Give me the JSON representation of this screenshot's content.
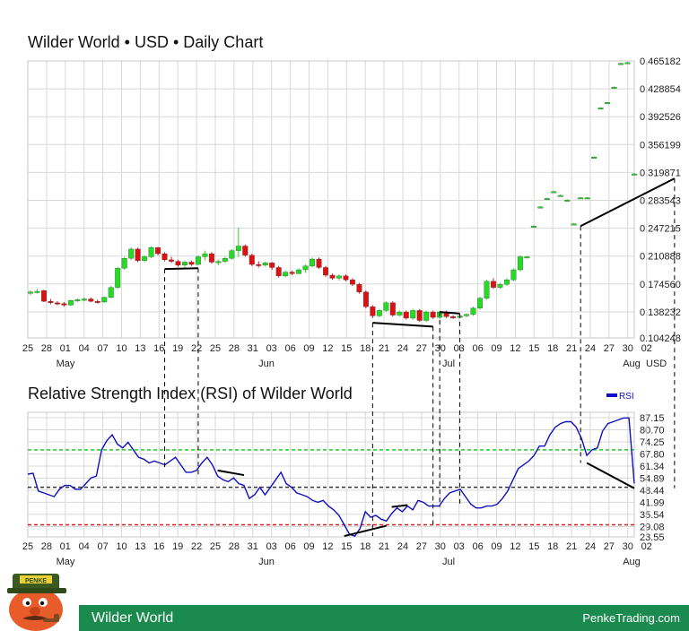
{
  "chart_data": [
    {
      "type": "candlestick",
      "title": "Wilder World • USD • Daily Chart",
      "y_unit": "USD",
      "ylim": [
        0.104248,
        0.465182
      ],
      "y_ticks": [
        "0.465182",
        "0.428854",
        "0.392526",
        "0.356199",
        "0.319871",
        "0.283543",
        "0.247215",
        "0.210888",
        "0.174560",
        "0.138232",
        "0.104248"
      ],
      "x_tick_labels": [
        "25",
        "28",
        "01",
        "04",
        "07",
        "10",
        "13",
        "16",
        "19",
        "22",
        "25",
        "28",
        "31",
        "03",
        "06",
        "09",
        "12",
        "15",
        "18",
        "21",
        "24",
        "27",
        "30",
        "03",
        "06",
        "09",
        "12",
        "15",
        "18",
        "21",
        "24",
        "27",
        "30",
        "02"
      ],
      "month_labels": [
        "May",
        "Jun",
        "Jul",
        "Aug"
      ],
      "grid": true,
      "ohlc": [
        [
          0.163,
          0.166,
          0.16,
          0.164
        ],
        [
          0.164,
          0.168,
          0.162,
          0.165
        ],
        [
          0.166,
          0.167,
          0.151,
          0.152
        ],
        [
          0.152,
          0.155,
          0.148,
          0.15
        ],
        [
          0.15,
          0.152,
          0.147,
          0.149
        ],
        [
          0.149,
          0.151,
          0.145,
          0.147
        ],
        [
          0.147,
          0.154,
          0.146,
          0.153
        ],
        [
          0.153,
          0.156,
          0.151,
          0.154
        ],
        [
          0.154,
          0.157,
          0.152,
          0.155
        ],
        [
          0.155,
          0.157,
          0.151,
          0.152
        ],
        [
          0.152,
          0.154,
          0.149,
          0.151
        ],
        [
          0.151,
          0.158,
          0.15,
          0.157
        ],
        [
          0.157,
          0.172,
          0.156,
          0.17
        ],
        [
          0.17,
          0.197,
          0.168,
          0.195
        ],
        [
          0.195,
          0.21,
          0.193,
          0.208
        ],
        [
          0.208,
          0.222,
          0.206,
          0.22
        ],
        [
          0.22,
          0.222,
          0.203,
          0.205
        ],
        [
          0.205,
          0.212,
          0.203,
          0.21
        ],
        [
          0.21,
          0.224,
          0.208,
          0.222
        ],
        [
          0.222,
          0.223,
          0.212,
          0.214
        ],
        [
          0.214,
          0.216,
          0.204,
          0.206
        ],
        [
          0.206,
          0.21,
          0.202,
          0.204
        ],
        [
          0.204,
          0.206,
          0.197,
          0.199
        ],
        [
          0.199,
          0.205,
          0.196,
          0.203
        ],
        [
          0.203,
          0.205,
          0.198,
          0.2
        ],
        [
          0.2,
          0.212,
          0.199,
          0.21
        ],
        [
          0.21,
          0.218,
          0.205,
          0.214
        ],
        [
          0.214,
          0.216,
          0.201,
          0.203
        ],
        [
          0.203,
          0.206,
          0.199,
          0.204
        ],
        [
          0.204,
          0.21,
          0.202,
          0.208
        ],
        [
          0.208,
          0.22,
          0.206,
          0.218
        ],
        [
          0.218,
          0.248,
          0.21,
          0.224
        ],
        [
          0.224,
          0.226,
          0.21,
          0.212
        ],
        [
          0.212,
          0.214,
          0.198,
          0.2
        ],
        [
          0.2,
          0.204,
          0.196,
          0.199
        ],
        [
          0.199,
          0.204,
          0.197,
          0.202
        ],
        [
          0.202,
          0.203,
          0.193,
          0.196
        ],
        [
          0.196,
          0.198,
          0.183,
          0.185
        ],
        [
          0.185,
          0.192,
          0.183,
          0.19
        ],
        [
          0.19,
          0.192,
          0.186,
          0.188
        ],
        [
          0.188,
          0.195,
          0.187,
          0.193
        ],
        [
          0.193,
          0.2,
          0.189,
          0.198
        ],
        [
          0.198,
          0.209,
          0.196,
          0.207
        ],
        [
          0.207,
          0.209,
          0.194,
          0.196
        ],
        [
          0.196,
          0.198,
          0.184,
          0.186
        ],
        [
          0.186,
          0.188,
          0.18,
          0.182
        ],
        [
          0.182,
          0.187,
          0.179,
          0.185
        ],
        [
          0.185,
          0.187,
          0.178,
          0.18
        ],
        [
          0.18,
          0.182,
          0.172,
          0.174
        ],
        [
          0.174,
          0.176,
          0.162,
          0.164
        ],
        [
          0.164,
          0.166,
          0.143,
          0.145
        ],
        [
          0.145,
          0.147,
          0.13,
          0.133
        ],
        [
          0.133,
          0.142,
          0.131,
          0.14
        ],
        [
          0.14,
          0.152,
          0.138,
          0.15
        ],
        [
          0.15,
          0.152,
          0.132,
          0.134
        ],
        [
          0.134,
          0.14,
          0.132,
          0.138
        ],
        [
          0.138,
          0.14,
          0.128,
          0.13
        ],
        [
          0.13,
          0.142,
          0.128,
          0.14
        ],
        [
          0.14,
          0.142,
          0.125,
          0.127
        ],
        [
          0.127,
          0.14,
          0.125,
          0.138
        ],
        [
          0.138,
          0.14,
          0.129,
          0.131
        ],
        [
          0.131,
          0.14,
          0.129,
          0.138
        ],
        [
          0.138,
          0.14,
          0.13,
          0.132
        ],
        [
          0.132,
          0.134,
          0.129,
          0.131
        ],
        [
          0.131,
          0.134,
          0.13,
          0.133
        ],
        [
          0.133,
          0.136,
          0.131,
          0.135
        ],
        [
          0.135,
          0.145,
          0.133,
          0.143
        ],
        [
          0.143,
          0.158,
          0.141,
          0.156
        ],
        [
          0.156,
          0.18,
          0.154,
          0.178
        ],
        [
          0.178,
          0.182,
          0.168,
          0.17
        ],
        [
          0.17,
          0.176,
          0.168,
          0.174
        ],
        [
          0.174,
          0.182,
          0.172,
          0.18
        ],
        [
          0.18,
          0.195,
          0.178,
          0.193
        ],
        [
          0.193,
          0.212,
          0.191,
          0.21
        ],
        [
          0.21,
          0.211,
          0.209,
          0.21
        ],
        [
          0.25,
          0.251,
          0.249,
          0.25
        ],
        [
          0.275,
          0.276,
          0.274,
          0.275
        ],
        [
          0.286,
          0.287,
          0.285,
          0.286
        ],
        [
          0.295,
          0.296,
          0.294,
          0.295
        ],
        [
          0.29,
          0.291,
          0.289,
          0.29
        ],
        [
          0.284,
          0.285,
          0.283,
          0.284
        ],
        [
          0.253,
          0.254,
          0.252,
          0.253
        ],
        [
          0.287,
          0.288,
          0.286,
          0.287
        ],
        [
          0.287,
          0.288,
          0.286,
          0.287
        ],
        [
          0.34,
          0.341,
          0.339,
          0.34
        ],
        [
          0.404,
          0.405,
          0.403,
          0.404
        ],
        [
          0.411,
          0.412,
          0.41,
          0.411
        ],
        [
          0.431,
          0.432,
          0.43,
          0.431
        ],
        [
          0.462,
          0.463,
          0.461,
          0.462
        ],
        [
          0.463,
          0.464,
          0.462,
          0.463
        ],
        [
          0.318,
          0.319,
          0.317,
          0.318
        ]
      ],
      "trend_lines": [
        {
          "from": [
            20,
            0.194
          ],
          "to": [
            25,
            0.195
          ]
        },
        {
          "from": [
            51,
            0.124
          ],
          "to": [
            60,
            0.119
          ]
        },
        {
          "from": [
            61,
            0.138
          ],
          "to": [
            64,
            0.136
          ]
        },
        {
          "from": [
            82,
            0.25
          ],
          "to": [
            96,
            0.312
          ]
        }
      ]
    },
    {
      "type": "line",
      "title": "Relative Strength Index (RSI) of Wilder World",
      "legend": "RSI",
      "legend_position": "top-right",
      "ylim": [
        23.55,
        90
      ],
      "y_ticks": [
        "87.15",
        "80.70",
        "74.25",
        "67.80",
        "61.34",
        "54.89",
        "48.44",
        "41.99",
        "35.54",
        "29.08",
        "23.55"
      ],
      "reference_lines": [
        {
          "value": 70,
          "color": "#22cc22"
        },
        {
          "value": 50,
          "color": "#333333"
        },
        {
          "value": 30,
          "color": "#dd2222"
        }
      ],
      "series": [
        {
          "name": "RSI",
          "color": "#1010c0",
          "values": [
            57,
            57.5,
            48,
            47,
            46,
            45,
            49,
            51,
            51,
            49,
            49,
            52,
            55,
            56,
            70,
            75,
            78,
            73,
            71,
            74,
            70,
            66,
            65,
            63,
            64,
            63,
            62,
            64,
            66,
            62,
            58,
            58,
            59,
            63,
            66,
            62,
            56,
            54,
            53,
            55,
            52,
            51,
            44,
            46,
            50,
            46,
            50,
            54,
            58,
            52,
            50,
            47,
            46,
            45,
            43,
            42,
            43,
            40,
            38,
            35,
            30,
            25,
            24,
            28,
            37,
            34,
            35,
            33,
            32,
            36,
            39,
            37,
            40,
            38,
            43,
            42,
            40,
            40,
            40,
            44,
            47,
            48,
            49,
            45,
            41,
            39,
            39,
            40,
            40,
            41,
            44,
            48,
            54,
            60,
            62,
            64,
            67,
            72,
            72,
            78,
            82,
            84,
            85,
            85,
            82,
            76,
            67,
            70,
            71,
            80,
            84,
            85,
            86,
            87,
            87,
            52
          ]
        }
      ],
      "trend_lines": [
        {
          "from": [
            36,
            59
          ],
          "to": [
            41,
            56.5
          ]
        },
        {
          "from": [
            60,
            24
          ],
          "to": [
            68,
            29.5
          ]
        },
        {
          "from": [
            69,
            39.5
          ],
          "to": [
            72,
            40.5
          ]
        },
        {
          "from": [
            106,
            63
          ],
          "to": [
            115,
            49.5
          ]
        }
      ],
      "x_tick_labels": [
        "25",
        "28",
        "01",
        "04",
        "07",
        "10",
        "13",
        "16",
        "19",
        "22",
        "25",
        "28",
        "31",
        "03",
        "06",
        "09",
        "12",
        "15",
        "18",
        "21",
        "24",
        "27",
        "30",
        "03",
        "06",
        "09",
        "12",
        "15",
        "18",
        "21",
        "24",
        "27",
        "30",
        "02"
      ],
      "month_labels": [
        "May",
        "Jun",
        "Jul",
        "Aug"
      ]
    }
  ],
  "footer": {
    "name": "Wilder World",
    "site": "PenkeTrading.com"
  },
  "mascot": {
    "badge": "PENKE"
  }
}
